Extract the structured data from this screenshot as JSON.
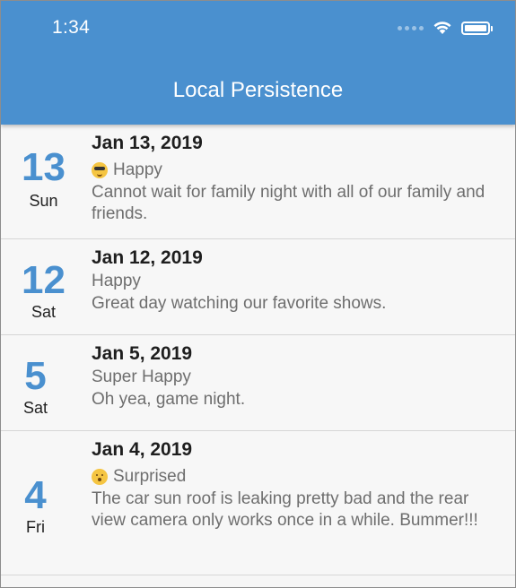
{
  "status_bar": {
    "time": "1:34",
    "signal_icon": "cellular-signal-dots",
    "wifi_icon": "wifi-icon",
    "battery_icon": "battery-icon"
  },
  "app_bar": {
    "title": "Local Persistence",
    "color": "#4a90cf"
  },
  "colors": {
    "accent": "#4a90cf",
    "muted_text": "#6e6e6e",
    "divider": "#d6d6d6"
  },
  "entries": [
    {
      "day_number": "13",
      "day_name": "Sun",
      "date": "Jan 13, 2019",
      "mood_icon": "smiling-face-with-sunglasses-emoji",
      "mood": "Happy",
      "note": "Cannot wait for family night with all of our family and friends."
    },
    {
      "day_number": "12",
      "day_name": "Sat",
      "date": "Jan 12, 2019",
      "mood": "Happy",
      "note": "Great day watching our favorite shows."
    },
    {
      "day_number": "5",
      "day_name": "Sat",
      "date": "Jan 5, 2019",
      "mood": "Super Happy",
      "note": "Oh yea, game night."
    },
    {
      "day_number": "4",
      "day_name": "Fri",
      "date": "Jan 4, 2019",
      "mood_icon": "hushed-face-emoji",
      "mood": "Surprised",
      "note": "The car sun roof is leaking pretty bad and the rear view camera only works once in a while. Bummer!!!"
    }
  ]
}
